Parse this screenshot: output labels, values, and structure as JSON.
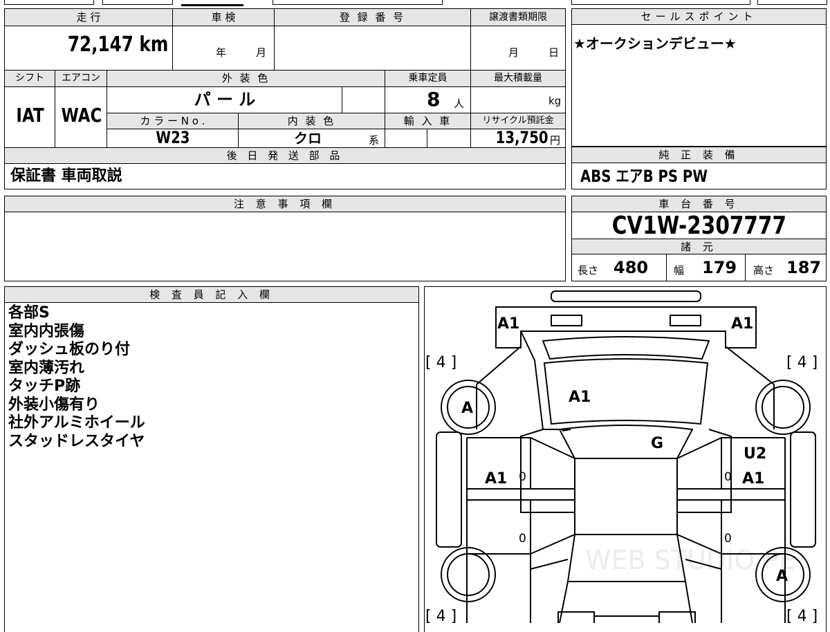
{
  "main_table": {
    "mileage_label": "走 行",
    "mileage_value": "72,147 km",
    "inspection_label": "車 検",
    "inspection_year_unit": "年",
    "inspection_month_unit": "月",
    "registration_label": "登 録 番 号",
    "transfer_deadline_label": "譲渡書類期限",
    "transfer_month_unit": "月",
    "transfer_day_unit": "日",
    "shift_label": "シフト",
    "shift_value": "IAT",
    "aircon_label": "エアコン",
    "aircon_value": "WAC",
    "exterior_color_label": "外 装 色",
    "exterior_color_value": "パ ー ル",
    "capacity_label": "乗車定員",
    "capacity_value": "8",
    "capacity_unit": "人",
    "max_load_label": "最大積載量",
    "max_load_unit": "kg",
    "color_no_label": "カ ラ ー N o .",
    "color_no_value": "W23",
    "interior_color_label": "内 装 色",
    "interior_color_value": "クロ",
    "interior_color_suffix": "系",
    "import_label": "輸 入 車",
    "recycle_label": "リサイクル預託金",
    "recycle_value": "13,750",
    "recycle_unit": "円",
    "later_parts_label": "後 日 発 送 部 品",
    "later_parts_value": "保証書 車両取説"
  },
  "sales_point": {
    "label": "セールスポイント",
    "value": "★オークションデビュー★"
  },
  "genuine_equipment": {
    "label": "純 正 装 備",
    "value": "ABS エアB PS PW"
  },
  "notes": {
    "label": "注 意 事 項 欄"
  },
  "chassis": {
    "label": "車 台 番 号",
    "value": "CV1W-2307777"
  },
  "specs": {
    "label": "諸 元",
    "length_label": "長さ",
    "length_value": "480",
    "width_label": "幅",
    "width_value": "179",
    "height_label": "高さ",
    "height_value": "187"
  },
  "inspector": {
    "label": "検 査 員 記 入 欄",
    "lines": [
      "各部S",
      "室内内張傷",
      "ダッシュ板のり付",
      "室内薄汚れ",
      "タッチP跡",
      "外装小傷有り",
      "社外アルミホイール",
      "スタッドレスタイヤ"
    ]
  },
  "diagram": {
    "marks": {
      "front_left": "A1",
      "front_right": "A1",
      "hood": "A1",
      "windshield": "G",
      "left_front_door": "A1",
      "right_front_door_top": "U2",
      "right_front_door": "A1",
      "front_left_wheel": "A",
      "rear_right_wheel": "A",
      "tread_fl": "[ 4 ]",
      "tread_fr": "[ 4 ]",
      "tread_rl": "[ 4 ]",
      "tread_rr": "[ 4 ]",
      "zero_1": "0",
      "zero_2": "0",
      "zero_3": "0",
      "zero_4": "0"
    },
    "watermark": "WEB STUDIO PE"
  }
}
